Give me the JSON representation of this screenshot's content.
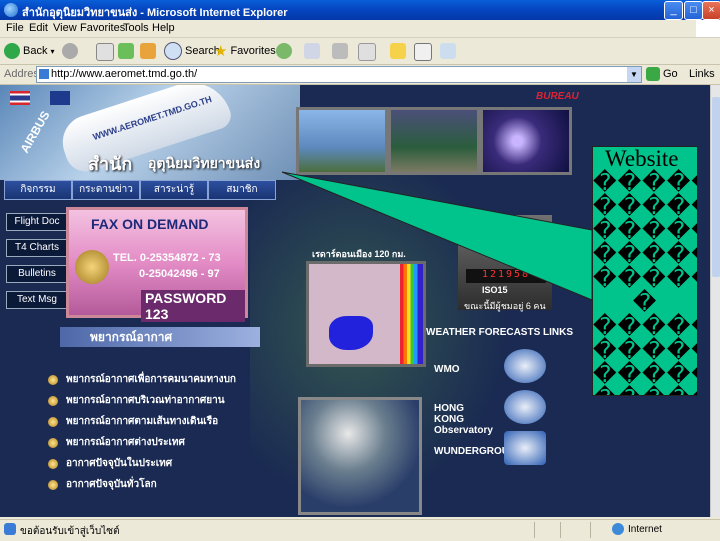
{
  "window": {
    "title": "สำนักอุตุนิยมวิทยาขนส่ง - Microsoft Internet Explorer",
    "controls": [
      "_",
      "□",
      "×"
    ]
  },
  "menu": [
    "File",
    "Edit",
    "View",
    "Favorites",
    "Tools",
    "Help"
  ],
  "toolbar": {
    "back": "Back",
    "search": "Search",
    "favorites": "Favorites"
  },
  "address": {
    "label": "Address",
    "url": "http://www.aeromet.tmd.go.th/",
    "go": "Go",
    "links": "Links"
  },
  "page": {
    "banner": {
      "plane_text": "WWW.AEROMET.TMD.GO.TH",
      "airbus": "AIRBUS",
      "brand": "สำนัก",
      "brand_sub": "อุตุนิยมวิทยาขนส่ง",
      "bureau": "BUREAU"
    },
    "nav": [
      "กิจกรรม",
      "กระดานข่าว",
      "สาระน่ารู้",
      "สมาชิก"
    ],
    "side": [
      "Flight Doc",
      "T4 Charts",
      "Bulletins",
      "Text Msg"
    ],
    "fax": {
      "title": "FAX ON DEMAND",
      "tel1": "TEL. 0-25354872 - 73",
      "tel2": "0-25042496 - 97",
      "password": "PASSWORD 123"
    },
    "forecast_header": "พยากรณ์อากาศ",
    "forecasts": [
      "พยากรณ์อากาศเพื่อการคมนาคมทางบก",
      "พยากรณ์อากาศบริเวณท่าอากาศยาน",
      "พยากรณ์อากาศตามเส้นทางเดินเรือ",
      "พยากรณ์อากาศต่างประเทศ",
      "อากาศปัจจุบันในประเทศ",
      "อากาศปัจจุบันทั่วโลก"
    ],
    "radar_caption": "เรดาร์ดอนเมือง 120 กม.",
    "iso": "ISO15",
    "counter": "121958",
    "online": "ขณะนี้มีผู้ชมอยู่ 6 คน",
    "links_header": "WEATHER FORECASTS LINKS",
    "links": [
      "WMO",
      "HONG KONG Observatory",
      "WUNDERGROUND"
    ]
  },
  "callout": {
    "word": "Website",
    "lines": [
      "�����",
      "�����",
      "�����",
      "�����",
      "�����",
      "�",
      "�����",
      "�����",
      "�����",
      "�����",
      "�����"
    ]
  },
  "status": {
    "left": "ขอต้อนรับเข้าสู่เว็บไซต์",
    "zone": "Internet"
  }
}
